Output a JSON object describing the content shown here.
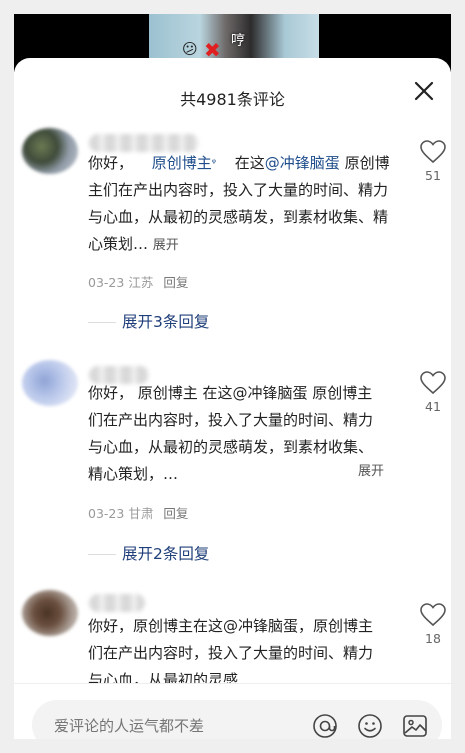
{
  "video": {
    "caption": "哼",
    "emoji": "😕",
    "x_mark": "✖"
  },
  "header": {
    "title": "共4981条评论",
    "close_icon": "close-icon"
  },
  "comments": [
    {
      "greeting": "你好，",
      "mention1": "原创博主",
      "mention_suffix": "ᵠ",
      "middle": "在这",
      "mention2": "@冲锋脑蛋",
      "body": "原创博主们在产出内容时，投入了大量的时间、精力与心血，从最初的灵感萌发，到素材收集、精心策划…",
      "expand": "展开",
      "meta_date": "03-23",
      "meta_location": "江苏",
      "reply_label": "回复",
      "likes": "51",
      "replies_toggle": "展开3条回复"
    },
    {
      "text": "你好，  原创博主  在这@冲锋脑蛋 原创博主们在产出内容时，投入了大量的时间、精力与心血，从最初的灵感萌发，到素材收集、精心策划，…",
      "expand": "展开",
      "meta_date": "03-23",
      "meta_location": "甘肃",
      "reply_label": "回复",
      "likes": "41",
      "replies_toggle": "展开2条回复"
    },
    {
      "text": "你好，原创博主在这@冲锋脑蛋，原创博主们在产出内容时，投入了大量的时间、精力与心血，从最初的灵感",
      "likes": "18"
    }
  ],
  "footer": {
    "placeholder": "爱评论的人运气都不差",
    "icons": [
      "at-icon",
      "emoji-icon",
      "image-icon"
    ]
  }
}
